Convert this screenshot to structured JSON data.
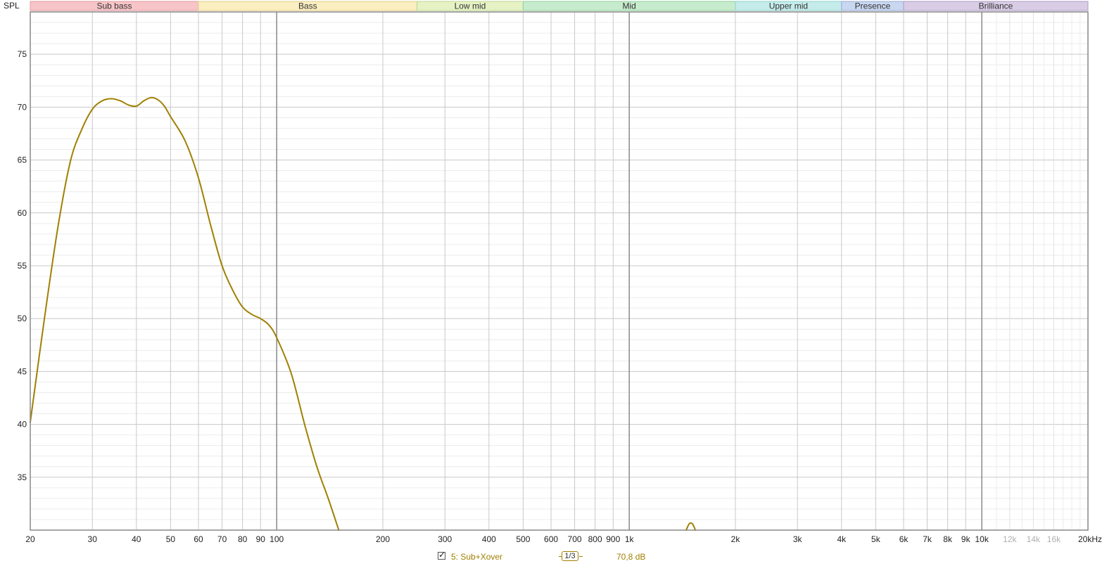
{
  "chart_data": {
    "type": "line",
    "ylabel": "SPL",
    "xscale": "log",
    "xlim": [
      20,
      20000
    ],
    "ylim": [
      30,
      79
    ],
    "grid": true,
    "y_ticks": [
      35,
      40,
      45,
      50,
      55,
      60,
      65,
      70,
      75
    ],
    "x_ticks": [
      {
        "value": 20,
        "label": "20"
      },
      {
        "value": 30,
        "label": "30"
      },
      {
        "value": 40,
        "label": "40"
      },
      {
        "value": 50,
        "label": "50"
      },
      {
        "value": 60,
        "label": "60"
      },
      {
        "value": 70,
        "label": "70"
      },
      {
        "value": 80,
        "label": "80"
      },
      {
        "value": 90,
        "label": "90"
      },
      {
        "value": 100,
        "label": "100"
      },
      {
        "value": 200,
        "label": "200"
      },
      {
        "value": 300,
        "label": "300"
      },
      {
        "value": 400,
        "label": "400"
      },
      {
        "value": 500,
        "label": "500"
      },
      {
        "value": 600,
        "label": "600"
      },
      {
        "value": 700,
        "label": "700"
      },
      {
        "value": 800,
        "label": "800"
      },
      {
        "value": 900,
        "label": "900"
      },
      {
        "value": 1000,
        "label": "1k"
      },
      {
        "value": 2000,
        "label": "2k"
      },
      {
        "value": 3000,
        "label": "3k"
      },
      {
        "value": 4000,
        "label": "4k"
      },
      {
        "value": 5000,
        "label": "5k"
      },
      {
        "value": 6000,
        "label": "6k"
      },
      {
        "value": 7000,
        "label": "7k"
      },
      {
        "value": 8000,
        "label": "8k"
      },
      {
        "value": 9000,
        "label": "9k"
      },
      {
        "value": 10000,
        "label": "10k"
      },
      {
        "value": 12000,
        "label": "12k",
        "muted": true
      },
      {
        "value": 14000,
        "label": "14k",
        "muted": true
      },
      {
        "value": 16000,
        "label": "16k",
        "muted": true
      },
      {
        "value": 20000,
        "label": "20kHz"
      }
    ],
    "bands": [
      {
        "name": "Sub bass",
        "from": 20,
        "to": 60,
        "color": "#f7c5c8",
        "border": "#e09aa0"
      },
      {
        "name": "Bass",
        "from": 60,
        "to": 250,
        "color": "#fbeec0",
        "border": "#e0cf8a"
      },
      {
        "name": "Low mid",
        "from": 250,
        "to": 500,
        "color": "#e6f2c4",
        "border": "#bcd68f"
      },
      {
        "name": "Mid",
        "from": 500,
        "to": 2000,
        "color": "#c7eccd",
        "border": "#8fcf9b"
      },
      {
        "name": "Upper mid",
        "from": 2000,
        "to": 4000,
        "color": "#c5ecea",
        "border": "#8fcfcb"
      },
      {
        "name": "Presence",
        "from": 4000,
        "to": 6000,
        "color": "#c9d7f0",
        "border": "#98acd6"
      },
      {
        "name": "Brilliance",
        "from": 6000,
        "to": 20000,
        "color": "#d9cde6",
        "border": "#ad9cc6"
      }
    ],
    "series": [
      {
        "name": "5: Sub+Xover",
        "color": "#a08000",
        "x": [
          20,
          22,
          24,
          26,
          28,
          30,
          32,
          34,
          36,
          38,
          40,
          42,
          44,
          46,
          48,
          50,
          55,
          60,
          65,
          70,
          75,
          80,
          85,
          90,
          95,
          100,
          110,
          120,
          130,
          140,
          150
        ],
        "y": [
          40.2,
          50.3,
          58.8,
          64.9,
          67.9,
          69.8,
          70.6,
          70.8,
          70.6,
          70.2,
          70.1,
          70.6,
          70.9,
          70.7,
          70.1,
          69.1,
          66.8,
          63.3,
          58.8,
          55.0,
          52.7,
          51.1,
          50.4,
          50.0,
          49.4,
          48.2,
          44.8,
          40.0,
          36.0,
          33.0,
          30.0
        ]
      },
      {
        "name": "5: Sub+Xover",
        "color": "#a08000",
        "x": [
          1450,
          1480,
          1510,
          1540
        ],
        "y": [
          30.0,
          30.6,
          30.6,
          30.0
        ]
      }
    ]
  },
  "legend": {
    "checked": true,
    "series_label": "5: Sub+Xover",
    "smoothing": "1/3",
    "value": "70,8 dB"
  }
}
